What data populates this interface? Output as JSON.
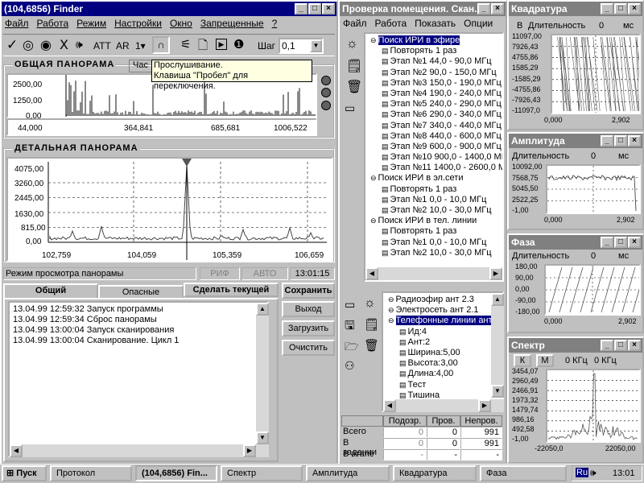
{
  "finder": {
    "title": "(104,6856) Finder",
    "menu": [
      "Файл",
      "Работа",
      "Режим",
      "Настройки",
      "Окно",
      "Запрещенные",
      "?"
    ],
    "toolbar": {
      "att": "ATT",
      "ar": "AR",
      "one": "1▾",
      "step_label": "Шаг",
      "step_value": "0,1"
    },
    "overview": {
      "title": "ОБЩАЯ ПАНОРАМА",
      "tab": "Час",
      "yticks": [
        "2500,00",
        "1250,00",
        "0,00"
      ],
      "xticks": [
        "44,000",
        "364,841",
        "685,681",
        "1006,522"
      ]
    },
    "tooltip": [
      "Прослушивание.",
      "Клавиша \"Пробел\" для переключения."
    ],
    "detail": {
      "title": "ДЕТАЛЬНАЯ ПАНОРАМА",
      "yticks": [
        "4075,00",
        "3260,00",
        "2445,00",
        "1630,00",
        "815,00",
        "0,00"
      ],
      "xticks": [
        "102,759",
        "104,059",
        "105,359",
        "106,659"
      ]
    },
    "status": {
      "mode": "Режим просмотра панорамы",
      "rif": "РИФ",
      "auto": "АВТО",
      "time": "13:01:15"
    },
    "tabs": [
      "Общий",
      "Опасные"
    ],
    "make_current": "Сделать текущей",
    "log": [
      "13.04.99 12:59:32 Запуск программы",
      "13.04.99 12:59:34 Сброс панорамы",
      "13.04.99 13:00:04 Запуск сканирования",
      "13.04.99 13:00:04 Сканирование. Цикл 1"
    ],
    "buttons": {
      "save": "Сохранить",
      "exit": "Выход",
      "load": "Загрузить",
      "clear": "Очистить"
    }
  },
  "check": {
    "title": "Проверка помещения. Скан...",
    "menu": [
      "Файл",
      "Работа",
      "Показать",
      "Опции"
    ],
    "tree": [
      {
        "t": "Поиск ИРИ в эфире",
        "lvl": 0,
        "sel": true
      },
      {
        "t": "Повторять 1 раз",
        "lvl": 1
      },
      {
        "t": "Этап №1 44,0 - 90,0 МГц",
        "lvl": 1
      },
      {
        "t": "Этап №2 90,0 - 150,0 МГц",
        "lvl": 1
      },
      {
        "t": "Этап №3 150,0 - 190,0 МГц",
        "lvl": 1
      },
      {
        "t": "Этап №4 190,0 - 240,0 МГц",
        "lvl": 1
      },
      {
        "t": "Этап №5 240,0 - 290,0 МГц",
        "lvl": 1
      },
      {
        "t": "Этап №6 290,0 - 340,0 МГц",
        "lvl": 1
      },
      {
        "t": "Этап №7 340,0 - 440,0 МГц",
        "lvl": 1
      },
      {
        "t": "Этап №8 440,0 - 600,0 МГц",
        "lvl": 1
      },
      {
        "t": "Этап №9 600,0 - 900,0 МГц",
        "lvl": 1
      },
      {
        "t": "Этап №10 900,0 - 1400,0 МГц",
        "lvl": 1
      },
      {
        "t": "Этап №11 1400,0 - 2600,0 МГц",
        "lvl": 1
      },
      {
        "t": "Поиск ИРИ в эл.сети",
        "lvl": 0
      },
      {
        "t": "Повторять 1 раз",
        "lvl": 1
      },
      {
        "t": "Этап №1  0,0 - 10,0 МГц",
        "lvl": 1
      },
      {
        "t": "Этап №2 10,0 - 30,0 МГц",
        "lvl": 1
      },
      {
        "t": "Поиск ИРИ в тел. линии",
        "lvl": 0
      },
      {
        "t": "Повторять 1 раз",
        "lvl": 1
      },
      {
        "t": "Этап №1  0,0 - 10,0 МГц",
        "lvl": 1
      },
      {
        "t": "Этап №2 10,0 - 30,0 МГц",
        "lvl": 1
      }
    ],
    "tree2": [
      {
        "t": "Радиоэфир ант 2.3",
        "lvl": 0
      },
      {
        "t": "Электросеть ант 2.1",
        "lvl": 0
      },
      {
        "t": "Телефонные линии ант",
        "lvl": 0,
        "sel": true
      },
      {
        "t": "Ид:4",
        "lvl": 1
      },
      {
        "t": "Ант:2",
        "lvl": 1
      },
      {
        "t": "Ширина:5,00",
        "lvl": 1
      },
      {
        "t": "Высота:3,00",
        "lvl": 1
      },
      {
        "t": "Длина:4,00",
        "lvl": 1
      },
      {
        "t": "Тест",
        "lvl": 1
      },
      {
        "t": "Тишина",
        "lvl": 1
      }
    ],
    "table": {
      "headers": [
        "",
        "Подозр.",
        "Пров.",
        "Непров."
      ],
      "rows": [
        [
          "Всего",
          "0",
          "0",
          "991"
        ],
        [
          "В задании",
          "0",
          "0",
          "991"
        ],
        [
          "В этапе",
          "-",
          "-",
          "-"
        ]
      ]
    }
  },
  "quad": {
    "title": "Квадратура",
    "b": "В",
    "len_label": "Длительность",
    "len_value": "0",
    "unit": "мс",
    "yticks": [
      "11097,00",
      "7926,43",
      "4755,86",
      "1585,29",
      "-1585,29",
      "-4755,86",
      "-7926,43",
      "-11097,0"
    ],
    "xticks": [
      "0,000",
      "2,902"
    ]
  },
  "amp": {
    "title": "Амплитуда",
    "len_label": "Длительность",
    "len_value": "0",
    "unit": "мс",
    "yticks": [
      "10092,00",
      "7568,75",
      "5045,50",
      "2522,25",
      "-1,00"
    ],
    "xticks": [
      "0,000",
      "2,902"
    ]
  },
  "phase": {
    "title": "Фаза",
    "len_label": "Длительность",
    "len_value": "0",
    "unit": "мс",
    "yticks": [
      "180,00",
      "90,00",
      "0,00",
      "-90,00",
      "-180,00"
    ],
    "xticks": [
      "0,000",
      "2,902"
    ]
  },
  "spec": {
    "title": "Спектр",
    "k": "К",
    "m": "М",
    "f1": "0 КГц",
    "f2": "0 КГц",
    "yticks": [
      "3454,07",
      "2960,49",
      "2466,91",
      "1973,32",
      "1479,74",
      "986,16",
      "492,58",
      "-1,00"
    ],
    "xticks": [
      "-22050,0",
      "22050,00"
    ]
  },
  "taskbar": {
    "start": "Пуск",
    "items": [
      "Протокол",
      "(104,6856) Fin...",
      "Спектр",
      "Амплитуда",
      "Квадратура",
      "Фаза"
    ],
    "lang": "Ru",
    "clock": "13:01"
  }
}
